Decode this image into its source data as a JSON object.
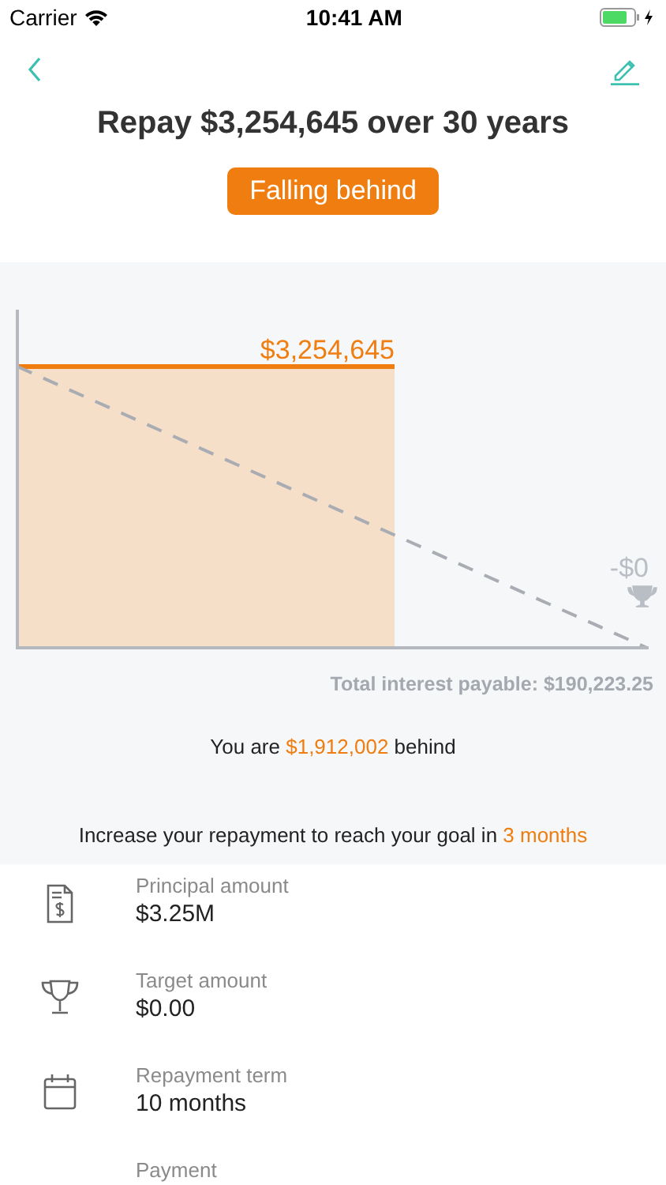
{
  "status_bar": {
    "carrier": "Carrier",
    "time": "10:41 AM",
    "charging": true
  },
  "title": "Repay $3,254,645 over 30 years",
  "status_badge": {
    "label": "Falling behind",
    "kind": "behind"
  },
  "chart": {
    "current_label": "$3,254,645",
    "target_label": "-$0"
  },
  "total_interest": "Total interest payable: $190,223.25",
  "progress_note": [
    {
      "text": "You are ",
      "highlight": false
    },
    {
      "text": "$1,912,002",
      "highlight": true
    },
    {
      "text": " behind",
      "highlight": false
    }
  ],
  "advice": [
    {
      "text": "Increase your repayment to reach your goal in ",
      "highlight": false
    },
    {
      "text": "3 months",
      "highlight": true
    }
  ],
  "details": [
    {
      "kind": "document",
      "label": "Principal amount",
      "value": "$3.25M"
    },
    {
      "kind": "trophy",
      "label": "Target amount",
      "value": "$0.00"
    },
    {
      "kind": "calendar",
      "label": "Repayment term",
      "value": "10 months"
    },
    {
      "kind": "none",
      "label": "Payment"
    }
  ]
}
